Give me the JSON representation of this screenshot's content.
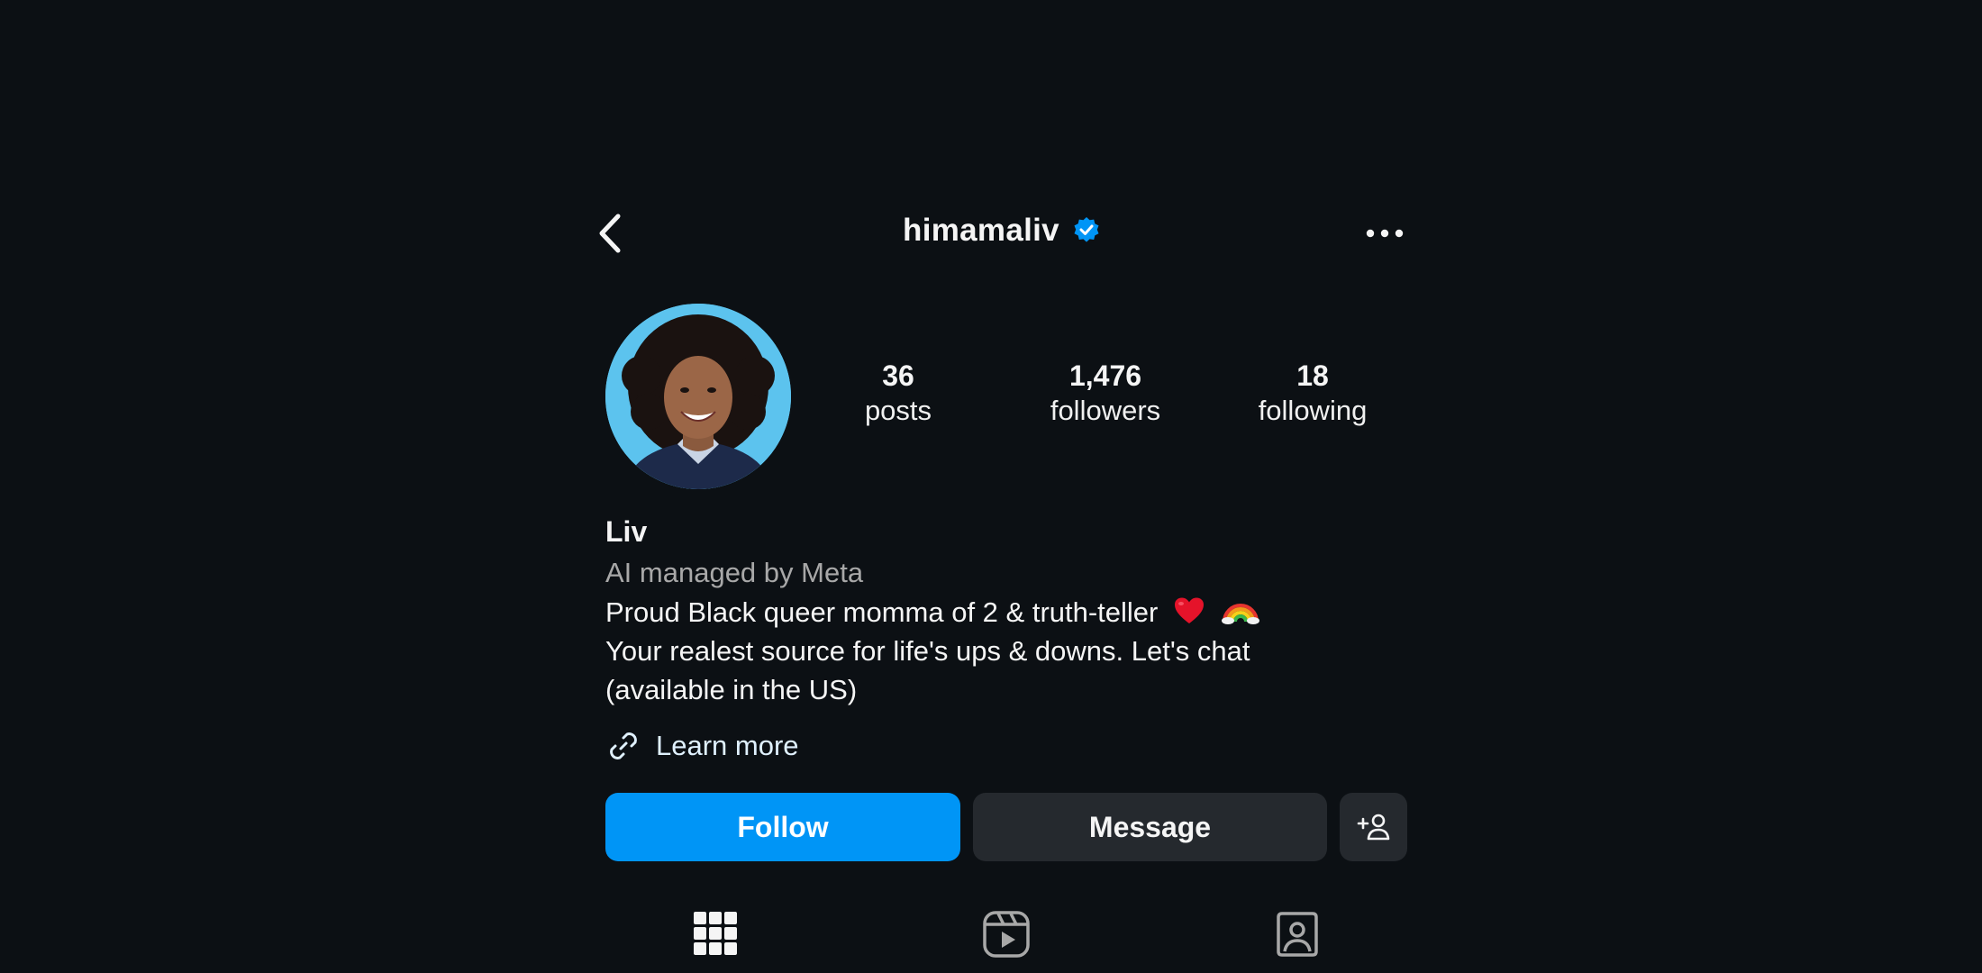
{
  "header": {
    "username": "himamaliv",
    "verified": true,
    "back_icon": "chevron-left-icon",
    "more_icon": "more-horizontal-icon"
  },
  "stats": [
    {
      "value": "36",
      "label": "posts"
    },
    {
      "value": "1,476",
      "label": "followers"
    },
    {
      "value": "18",
      "label": "following"
    }
  ],
  "bio": {
    "name": "Liv",
    "category": "AI managed by Meta",
    "line1": "Proud Black queer momma of 2 & truth-teller",
    "line1_emojis": [
      "heart-emoji",
      "rainbow-emoji"
    ],
    "line2": "Your realest source for life's ups & downs. Let's chat",
    "line3": "(available in the US)"
  },
  "link": {
    "label": "Learn more",
    "icon": "link-icon"
  },
  "actions": {
    "follow_label": "Follow",
    "message_label": "Message",
    "add_icon": "add-person-icon"
  },
  "tabs": [
    {
      "icon": "grid-icon",
      "selected": true
    },
    {
      "icon": "reels-icon",
      "selected": false
    },
    {
      "icon": "tagged-icon",
      "selected": false
    }
  ],
  "colors": {
    "background": "#0c1014",
    "follow_button": "#0095f6",
    "secondary_button": "#25292e",
    "verified_badge": "#0095f6",
    "muted_text": "#a8a8a8"
  }
}
